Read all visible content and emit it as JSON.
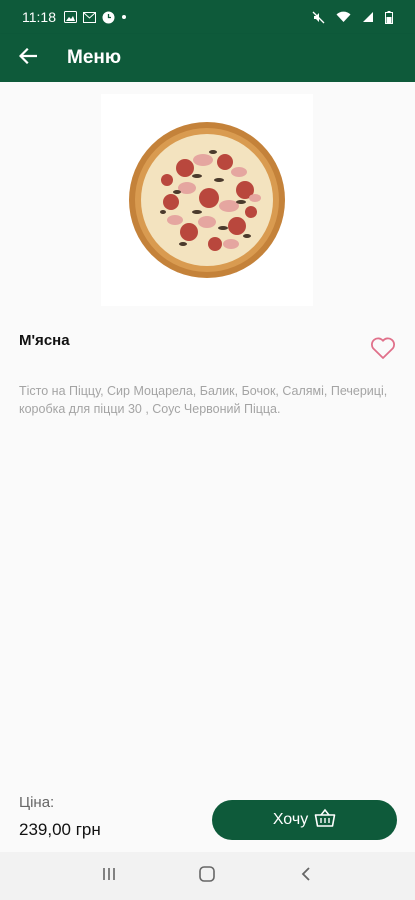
{
  "status_bar": {
    "time": "11:18",
    "left_icons": [
      "image-icon",
      "mail-icon",
      "clock-icon",
      "dot-icon"
    ],
    "right_icons": [
      "mute-icon",
      "wifi-icon",
      "signal-icon",
      "battery-icon"
    ]
  },
  "app_bar": {
    "title": "Меню",
    "back_icon": "arrow-left-icon"
  },
  "product": {
    "name": "М'ясна",
    "description": "Тісто на Піццу, Сир Моцарела, Балик, Бочок, Салямі, Печериці, коробка для піцци 30 , Соус Червоний Піцца.",
    "favorite_icon": "heart-outline-icon"
  },
  "footer": {
    "price_label": "Ціна:",
    "price_value": "239,00 грн",
    "want_label": "Хочу",
    "basket_icon": "basket-icon"
  },
  "nav_bar": {
    "icons": [
      "recent-apps-icon",
      "home-icon",
      "back-icon"
    ]
  },
  "colors": {
    "primary": "#0e5a3a",
    "heart": "#e0708a",
    "description": "#a4a4a4"
  }
}
